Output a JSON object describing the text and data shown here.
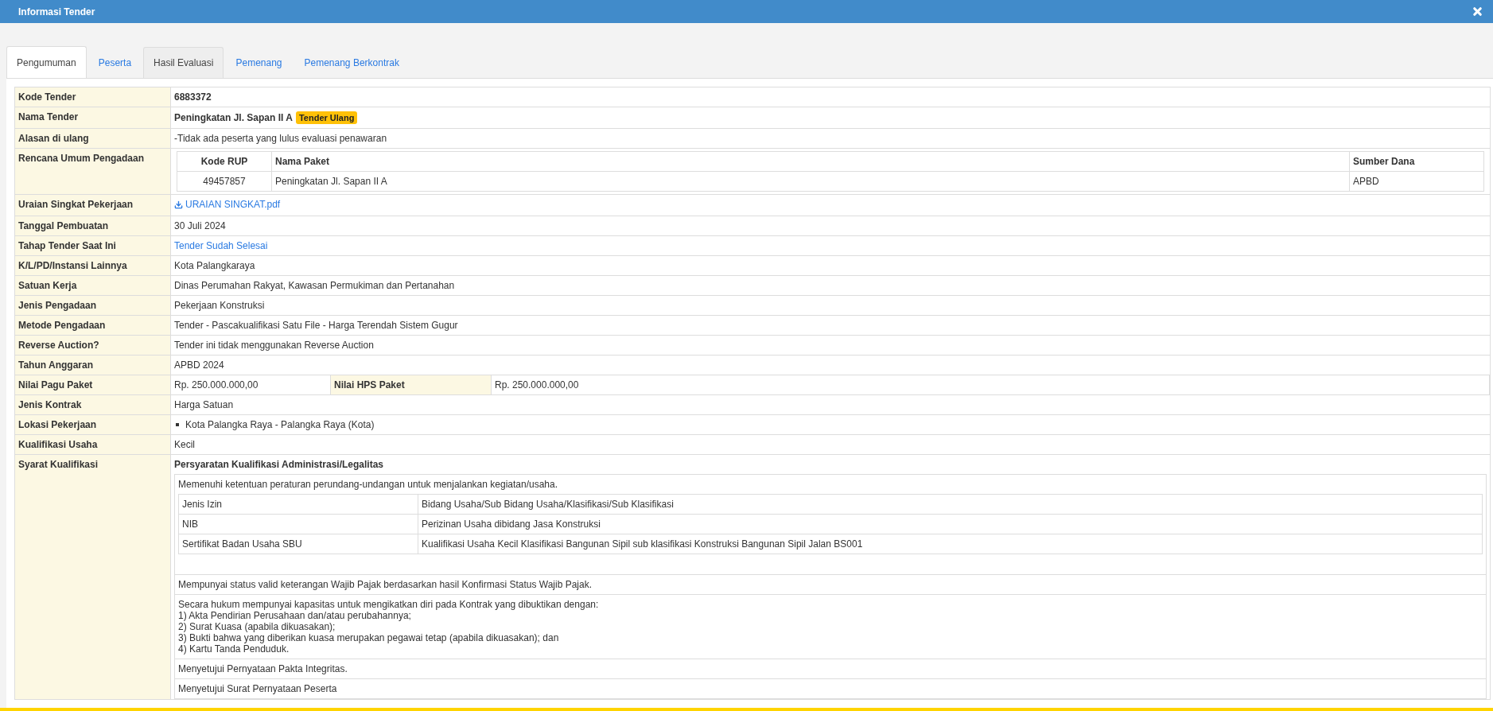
{
  "window": {
    "title": "Informasi Tender"
  },
  "tabs": [
    {
      "label": "Pengumuman",
      "selected": true,
      "hovered": false
    },
    {
      "label": "Peserta",
      "selected": false,
      "hovered": false
    },
    {
      "label": "Hasil Evaluasi",
      "selected": false,
      "hovered": true
    },
    {
      "label": "Pemenang",
      "selected": false,
      "hovered": false
    },
    {
      "label": "Pemenang Berkontrak",
      "selected": false,
      "hovered": false
    }
  ],
  "fields": [
    {
      "kind": "strong",
      "label": "Kode Tender",
      "value": "6883372"
    },
    {
      "kind": "badge",
      "label": "Nama Tender",
      "value": "Peningkatan Jl. Sapan II A",
      "badge": "Tender Ulang"
    },
    {
      "kind": "text",
      "label": "Alasan di ulang",
      "value": "-Tidak ada peserta yang lulus evaluasi penawaran"
    },
    {
      "kind": "rup",
      "label": "Rencana Umum Pengadaan",
      "columns": [
        "Kode RUP",
        "Nama Paket",
        "Sumber Dana"
      ],
      "rows": [
        [
          "49457857",
          "Peningkatan Jl. Sapan II A",
          "APBD"
        ]
      ]
    },
    {
      "kind": "file",
      "label": "Uraian Singkat Pekerjaan",
      "value": "URAIAN SINGKAT.pdf"
    },
    {
      "kind": "text",
      "label": "Tanggal Pembuatan",
      "value": "30 Juli 2024"
    },
    {
      "kind": "link",
      "label": "Tahap Tender Saat Ini",
      "value": "Tender Sudah Selesai"
    },
    {
      "kind": "text",
      "label": "K/L/PD/Instansi Lainnya",
      "value": "Kota Palangkaraya"
    },
    {
      "kind": "text",
      "label": "Satuan Kerja",
      "value": "Dinas Perumahan Rakyat, Kawasan Permukiman dan Pertanahan"
    },
    {
      "kind": "text",
      "label": "Jenis Pengadaan",
      "value": "Pekerjaan Konstruksi"
    },
    {
      "kind": "text",
      "label": "Metode Pengadaan",
      "value": "Tender - Pascakualifikasi Satu File - Harga Terendah Sistem Gugur"
    },
    {
      "kind": "text",
      "label": "Reverse Auction?",
      "value": "Tender ini tidak menggunakan Reverse Auction"
    },
    {
      "kind": "text",
      "label": "Tahun Anggaran",
      "value": "APBD 2024"
    },
    {
      "kind": "pair",
      "label": "Nilai Pagu Paket",
      "value": "Rp. 250.000.000,00",
      "label_2": "Nilai HPS Paket",
      "value_2": "Rp. 250.000.000,00"
    },
    {
      "kind": "text",
      "label": "Jenis Kontrak",
      "value": "Harga Satuan"
    },
    {
      "kind": "bullets",
      "label": "Lokasi Pekerjaan",
      "items": [
        "Kota Palangka Raya - Palangka Raya (Kota)"
      ]
    },
    {
      "kind": "text",
      "label": "Kualifikasi Usaha",
      "value": "Kecil"
    },
    {
      "kind": "requirements",
      "label": "Syarat Kualifikasi",
      "heading": "Persyaratan Kualifikasi Administrasi/Legalitas",
      "items": [
        {
          "kind": "table",
          "text": "Memenuhi ketentuan peraturan perundang-undangan untuk menjalankan kegiatan/usaha.",
          "rows": [
            [
              "Jenis Izin",
              "Bidang Usaha/Sub Bidang Usaha/Klasifikasi/Sub Klasifikasi"
            ],
            [
              "NIB",
              "Perizinan Usaha dibidang Jasa Konstruksi"
            ],
            [
              "Sertifikat Badan Usaha SBU",
              "Kualifikasi Usaha Kecil Klasifikasi Bangunan Sipil sub klasifikasi Konstruksi Bangunan Sipil Jalan BS001"
            ]
          ]
        },
        {
          "kind": "text",
          "text": "Mempunyai status valid keterangan Wajib Pajak berdasarkan hasil Konfirmasi Status Wajib Pajak."
        },
        {
          "kind": "text",
          "text": "Secara hukum mempunyai kapasitas untuk mengikatkan diri pada Kontrak yang dibuktikan dengan:\n1) Akta Pendirian Perusahaan dan/atau perubahannya;\n2) Surat Kuasa (apabila dikuasakan);\n3) Bukti bahwa yang diberikan kuasa merupakan pegawai tetap (apabila dikuasakan); dan\n4) Kartu Tanda Penduduk."
        },
        {
          "kind": "text",
          "text": "Menyetujui Pernyataan Pakta Integritas."
        },
        {
          "kind": "text",
          "text": "Menyetujui Surat Pernyataan Peserta"
        }
      ]
    }
  ]
}
